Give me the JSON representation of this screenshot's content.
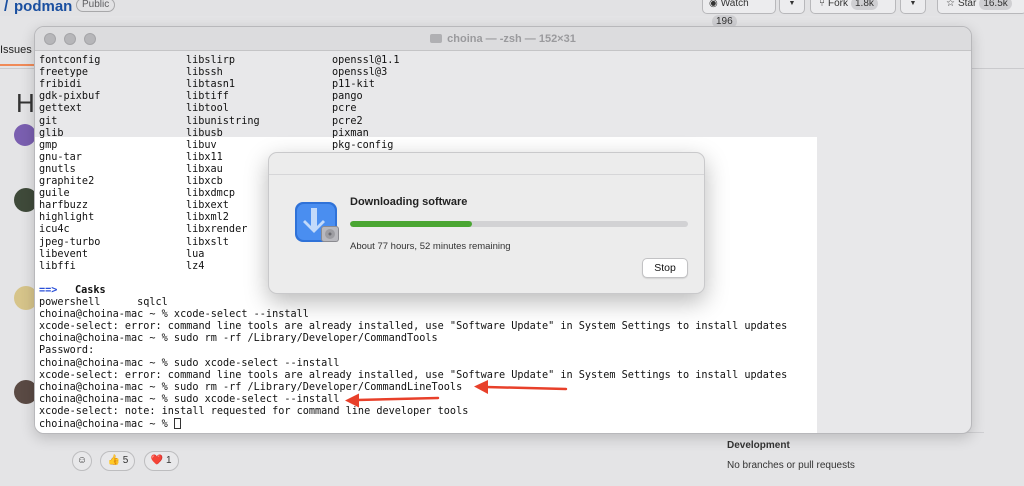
{
  "github": {
    "repo_slash": "/",
    "repo_name": "podman",
    "visibility": "Public",
    "watch": {
      "label": "Watch",
      "count": "196"
    },
    "fork": {
      "label": "Fork",
      "count": "1.8k"
    },
    "star": {
      "label": "Star",
      "count": "16.5k"
    },
    "tab_issues": "Issues",
    "heading_letter": "H",
    "reactions": [
      {
        "emoji": "👍",
        "count": "5"
      },
      {
        "emoji": "❤️",
        "count": "1"
      }
    ],
    "sidebar": {
      "section_title": "Development",
      "section_text": "No branches or pull requests"
    }
  },
  "terminal": {
    "title": "choina — -zsh — 152×31",
    "formula_rows": [
      [
        "fontconfig",
        "libslirp",
        "openssl@1.1"
      ],
      [
        "freetype",
        "libssh",
        "openssl@3"
      ],
      [
        "fribidi",
        "libtasn1",
        "p11-kit"
      ],
      [
        "gdk-pixbuf",
        "libtiff",
        "pango"
      ],
      [
        "gettext",
        "libtool",
        "pcre"
      ],
      [
        "git",
        "libunistring",
        "pcre2"
      ],
      [
        "glib",
        "libusb",
        "pixman"
      ],
      [
        "gmp",
        "libuv",
        "pkg-config"
      ],
      [
        "gnu-tar",
        "libx11",
        ""
      ],
      [
        "gnutls",
        "libxau",
        ""
      ],
      [
        "graphite2",
        "libxcb",
        ""
      ],
      [
        "guile",
        "libxdmcp",
        ""
      ],
      [
        "harfbuzz",
        "libxext",
        ""
      ],
      [
        "highlight",
        "libxml2",
        ""
      ],
      [
        "icu4c",
        "libxrender",
        ""
      ],
      [
        "jpeg-turbo",
        "libxslt",
        ""
      ],
      [
        "libevent",
        "lua",
        ""
      ],
      [
        "libffi",
        "lz4",
        ""
      ]
    ],
    "casks_arrow": "==>",
    "casks_label": "Casks",
    "casks_line": "powershell      sqlcl",
    "output_lines": [
      "choina@choina-mac ~ % xcode-select --install",
      "xcode-select: error: command line tools are already installed, use \"Software Update\" in System Settings to install updates",
      "choina@choina-mac ~ % sudo rm -rf /Library/Developer/CommandTools",
      "Password:",
      "choina@choina-mac ~ % sudo xcode-select --install",
      "xcode-select: error: command line tools are already installed, use \"Software Update\" in System Settings to install updates",
      "choina@choina-mac ~ % sudo rm -rf /Library/Developer/CommandLineTools",
      "choina@choina-mac ~ % sudo xcode-select --install",
      "xcode-select: note: install requested for command line developer tools",
      "choina@choina-mac ~ % "
    ]
  },
  "dialog": {
    "title": "Downloading software",
    "progress": 0.36,
    "remaining": "About 77 hours, 52 minutes remaining",
    "stop_label": "Stop"
  },
  "colors": {
    "progress_green": "#4aa632",
    "annotation_red": "#e8402a",
    "cask_blue": "#2a50d8",
    "link_blue": "#1a4fa0"
  }
}
